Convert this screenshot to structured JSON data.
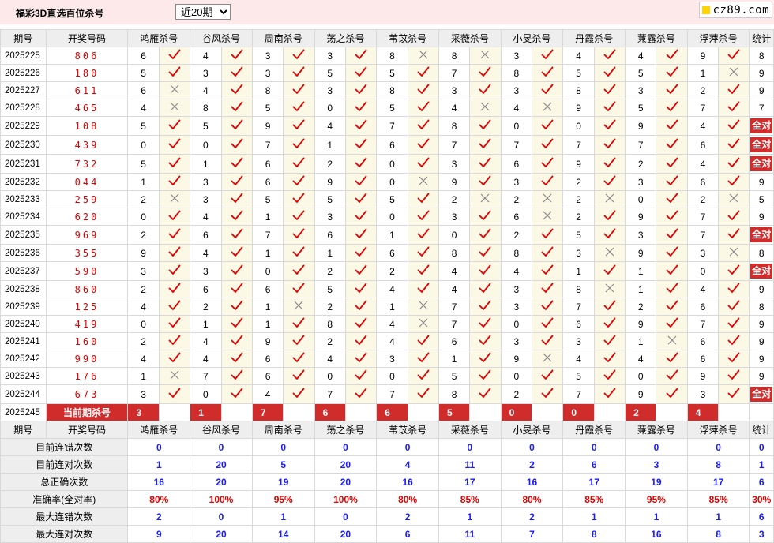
{
  "header": {
    "title": "福彩3D直选百位杀号",
    "period_select": {
      "value": "近20期",
      "options": [
        "近20期"
      ]
    },
    "logo_text": "cz89.com"
  },
  "columns": {
    "issue": "期号",
    "draw": "开奖号码",
    "experts": [
      "鸿雁杀号",
      "谷风杀号",
      "周南杀号",
      "荡之杀号",
      "苇苡杀号",
      "采薇杀号",
      "小旻杀号",
      "丹霞杀号",
      "蒹露杀号",
      "浮萍杀号"
    ],
    "stats": "统计"
  },
  "all_correct_label": "全对",
  "rows": [
    {
      "issue": "2025225",
      "draw": "806",
      "kills": [
        [
          6,
          1
        ],
        [
          4,
          1
        ],
        [
          3,
          1
        ],
        [
          3,
          1
        ],
        [
          8,
          0
        ],
        [
          8,
          0
        ],
        [
          3,
          1
        ],
        [
          4,
          1
        ],
        [
          4,
          1
        ],
        [
          9,
          1
        ]
      ],
      "stat": "8"
    },
    {
      "issue": "2025226",
      "draw": "180",
      "kills": [
        [
          5,
          1
        ],
        [
          3,
          1
        ],
        [
          3,
          1
        ],
        [
          5,
          1
        ],
        [
          5,
          1
        ],
        [
          7,
          1
        ],
        [
          8,
          1
        ],
        [
          5,
          1
        ],
        [
          5,
          1
        ],
        [
          1,
          0
        ]
      ],
      "stat": "9"
    },
    {
      "issue": "2025227",
      "draw": "611",
      "kills": [
        [
          6,
          0
        ],
        [
          4,
          1
        ],
        [
          8,
          1
        ],
        [
          3,
          1
        ],
        [
          8,
          1
        ],
        [
          3,
          1
        ],
        [
          3,
          1
        ],
        [
          8,
          1
        ],
        [
          3,
          1
        ],
        [
          2,
          1
        ]
      ],
      "stat": "9"
    },
    {
      "issue": "2025228",
      "draw": "465",
      "kills": [
        [
          4,
          0
        ],
        [
          8,
          1
        ],
        [
          5,
          1
        ],
        [
          0,
          1
        ],
        [
          5,
          1
        ],
        [
          4,
          0
        ],
        [
          4,
          0
        ],
        [
          9,
          1
        ],
        [
          5,
          1
        ],
        [
          7,
          1
        ]
      ],
      "stat": "7"
    },
    {
      "issue": "2025229",
      "draw": "108",
      "kills": [
        [
          5,
          1
        ],
        [
          5,
          1
        ],
        [
          9,
          1
        ],
        [
          4,
          1
        ],
        [
          7,
          1
        ],
        [
          8,
          1
        ],
        [
          0,
          1
        ],
        [
          0,
          1
        ],
        [
          9,
          1
        ],
        [
          4,
          1
        ]
      ],
      "stat": "全对"
    },
    {
      "issue": "2025230",
      "draw": "439",
      "kills": [
        [
          0,
          1
        ],
        [
          0,
          1
        ],
        [
          7,
          1
        ],
        [
          1,
          1
        ],
        [
          6,
          1
        ],
        [
          7,
          1
        ],
        [
          7,
          1
        ],
        [
          7,
          1
        ],
        [
          7,
          1
        ],
        [
          6,
          1
        ]
      ],
      "stat": "全对"
    },
    {
      "issue": "2025231",
      "draw": "732",
      "kills": [
        [
          5,
          1
        ],
        [
          1,
          1
        ],
        [
          6,
          1
        ],
        [
          2,
          1
        ],
        [
          0,
          1
        ],
        [
          3,
          1
        ],
        [
          6,
          1
        ],
        [
          9,
          1
        ],
        [
          2,
          1
        ],
        [
          4,
          1
        ]
      ],
      "stat": "全对"
    },
    {
      "issue": "2025232",
      "draw": "044",
      "kills": [
        [
          1,
          1
        ],
        [
          3,
          1
        ],
        [
          6,
          1
        ],
        [
          9,
          1
        ],
        [
          0,
          0
        ],
        [
          9,
          1
        ],
        [
          3,
          1
        ],
        [
          2,
          1
        ],
        [
          3,
          1
        ],
        [
          6,
          1
        ]
      ],
      "stat": "9"
    },
    {
      "issue": "2025233",
      "draw": "259",
      "kills": [
        [
          2,
          0
        ],
        [
          3,
          1
        ],
        [
          5,
          1
        ],
        [
          5,
          1
        ],
        [
          5,
          1
        ],
        [
          2,
          0
        ],
        [
          2,
          0
        ],
        [
          2,
          0
        ],
        [
          0,
          1
        ],
        [
          2,
          0
        ]
      ],
      "stat": "5"
    },
    {
      "issue": "2025234",
      "draw": "620",
      "kills": [
        [
          0,
          1
        ],
        [
          4,
          1
        ],
        [
          1,
          1
        ],
        [
          3,
          1
        ],
        [
          0,
          1
        ],
        [
          3,
          1
        ],
        [
          6,
          0
        ],
        [
          2,
          1
        ],
        [
          9,
          1
        ],
        [
          7,
          1
        ]
      ],
      "stat": "9"
    },
    {
      "issue": "2025235",
      "draw": "969",
      "kills": [
        [
          2,
          1
        ],
        [
          6,
          1
        ],
        [
          7,
          1
        ],
        [
          6,
          1
        ],
        [
          1,
          1
        ],
        [
          0,
          1
        ],
        [
          2,
          1
        ],
        [
          5,
          1
        ],
        [
          3,
          1
        ],
        [
          7,
          1
        ]
      ],
      "stat": "全对"
    },
    {
      "issue": "2025236",
      "draw": "355",
      "kills": [
        [
          9,
          1
        ],
        [
          4,
          1
        ],
        [
          1,
          1
        ],
        [
          1,
          1
        ],
        [
          6,
          1
        ],
        [
          8,
          1
        ],
        [
          8,
          1
        ],
        [
          3,
          0
        ],
        [
          9,
          1
        ],
        [
          3,
          0
        ]
      ],
      "stat": "8"
    },
    {
      "issue": "2025237",
      "draw": "590",
      "kills": [
        [
          3,
          1
        ],
        [
          3,
          1
        ],
        [
          0,
          1
        ],
        [
          2,
          1
        ],
        [
          2,
          1
        ],
        [
          4,
          1
        ],
        [
          4,
          1
        ],
        [
          1,
          1
        ],
        [
          1,
          1
        ],
        [
          0,
          1
        ]
      ],
      "stat": "全对"
    },
    {
      "issue": "2025238",
      "draw": "860",
      "kills": [
        [
          2,
          1
        ],
        [
          6,
          1
        ],
        [
          6,
          1
        ],
        [
          5,
          1
        ],
        [
          4,
          1
        ],
        [
          4,
          1
        ],
        [
          3,
          1
        ],
        [
          8,
          0
        ],
        [
          1,
          1
        ],
        [
          4,
          1
        ]
      ],
      "stat": "9"
    },
    {
      "issue": "2025239",
      "draw": "125",
      "kills": [
        [
          4,
          1
        ],
        [
          2,
          1
        ],
        [
          1,
          0
        ],
        [
          2,
          1
        ],
        [
          1,
          0
        ],
        [
          7,
          1
        ],
        [
          3,
          1
        ],
        [
          7,
          1
        ],
        [
          2,
          1
        ],
        [
          6,
          1
        ]
      ],
      "stat": "8"
    },
    {
      "issue": "2025240",
      "draw": "419",
      "kills": [
        [
          0,
          1
        ],
        [
          1,
          1
        ],
        [
          1,
          1
        ],
        [
          8,
          1
        ],
        [
          4,
          0
        ],
        [
          7,
          1
        ],
        [
          0,
          1
        ],
        [
          6,
          1
        ],
        [
          9,
          1
        ],
        [
          7,
          1
        ]
      ],
      "stat": "9"
    },
    {
      "issue": "2025241",
      "draw": "160",
      "kills": [
        [
          2,
          1
        ],
        [
          4,
          1
        ],
        [
          9,
          1
        ],
        [
          2,
          1
        ],
        [
          4,
          1
        ],
        [
          6,
          1
        ],
        [
          3,
          1
        ],
        [
          3,
          1
        ],
        [
          1,
          0
        ],
        [
          6,
          1
        ]
      ],
      "stat": "9"
    },
    {
      "issue": "2025242",
      "draw": "990",
      "kills": [
        [
          4,
          1
        ],
        [
          4,
          1
        ],
        [
          6,
          1
        ],
        [
          4,
          1
        ],
        [
          3,
          1
        ],
        [
          1,
          1
        ],
        [
          9,
          0
        ],
        [
          4,
          1
        ],
        [
          4,
          1
        ],
        [
          6,
          1
        ]
      ],
      "stat": "9"
    },
    {
      "issue": "2025243",
      "draw": "176",
      "kills": [
        [
          1,
          0
        ],
        [
          7,
          1
        ],
        [
          6,
          1
        ],
        [
          0,
          1
        ],
        [
          0,
          1
        ],
        [
          5,
          1
        ],
        [
          0,
          1
        ],
        [
          5,
          1
        ],
        [
          0,
          1
        ],
        [
          9,
          1
        ]
      ],
      "stat": "9"
    },
    {
      "issue": "2025244",
      "draw": "673",
      "kills": [
        [
          3,
          1
        ],
        [
          0,
          1
        ],
        [
          4,
          1
        ],
        [
          7,
          1
        ],
        [
          7,
          1
        ],
        [
          8,
          1
        ],
        [
          2,
          1
        ],
        [
          7,
          1
        ],
        [
          9,
          1
        ],
        [
          3,
          1
        ]
      ],
      "stat": "全对"
    }
  ],
  "current": {
    "issue": "2025245",
    "label": "当前期杀号",
    "kills": [
      "3",
      "1",
      "7",
      "6",
      "6",
      "5",
      "0",
      "0",
      "2",
      "4"
    ]
  },
  "summary": [
    {
      "label": "目前连错次数",
      "values": [
        "0",
        "0",
        "0",
        "0",
        "0",
        "0",
        "0",
        "0",
        "0",
        "0"
      ],
      "stat": "0"
    },
    {
      "label": "目前连对次数",
      "values": [
        "1",
        "20",
        "5",
        "20",
        "4",
        "11",
        "2",
        "6",
        "3",
        "8"
      ],
      "stat": "1"
    },
    {
      "label": "总正确次数",
      "values": [
        "16",
        "20",
        "19",
        "20",
        "16",
        "17",
        "16",
        "17",
        "19",
        "17"
      ],
      "stat": "6"
    },
    {
      "label": "准确率(全对率)",
      "values": [
        "80%",
        "100%",
        "95%",
        "100%",
        "80%",
        "85%",
        "80%",
        "85%",
        "95%",
        "85%"
      ],
      "stat": "30%"
    },
    {
      "label": "最大连错次数",
      "values": [
        "2",
        "0",
        "1",
        "0",
        "2",
        "1",
        "2",
        "1",
        "1",
        "1"
      ],
      "stat": "6"
    },
    {
      "label": "最大连对次数",
      "values": [
        "9",
        "20",
        "14",
        "20",
        "6",
        "11",
        "7",
        "8",
        "16",
        "8"
      ],
      "stat": "3"
    }
  ]
}
